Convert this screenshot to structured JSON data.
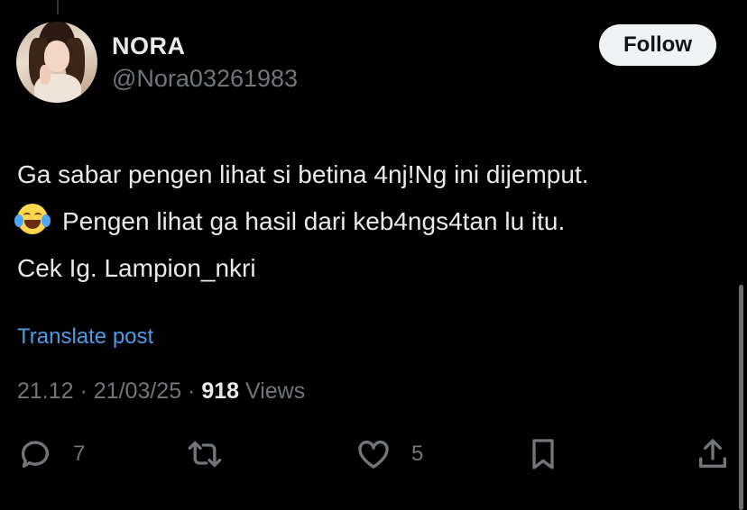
{
  "user": {
    "name": "NORA",
    "handle": "@Nora03261983"
  },
  "follow_label": "Follow",
  "post": {
    "line1": "Ga sabar pengen lihat si betina 4nj!Ng ini dijemput.",
    "line2_emoji": "face-with-tears-of-joy",
    "line2": "Pengen lihat ga hasil dari keb4ngs4tan lu itu.",
    "line3": "Cek Ig. Lampion_nkri"
  },
  "translate_label": "Translate post",
  "meta": {
    "time": "21.12",
    "sep1": " · ",
    "date": "21/03/25",
    "sep2": " · ",
    "views_count": "918",
    "views_label": " Views"
  },
  "actions": {
    "reply_count": "7",
    "like_count": "5",
    "icons": [
      "reply-icon",
      "repost-icon",
      "like-icon",
      "bookmark-icon",
      "share-icon"
    ]
  },
  "colors": {
    "background": "#000000",
    "text": "#e7e9ea",
    "muted": "#71767b",
    "link": "#4c9be8",
    "button_bg": "#eff3f4"
  }
}
